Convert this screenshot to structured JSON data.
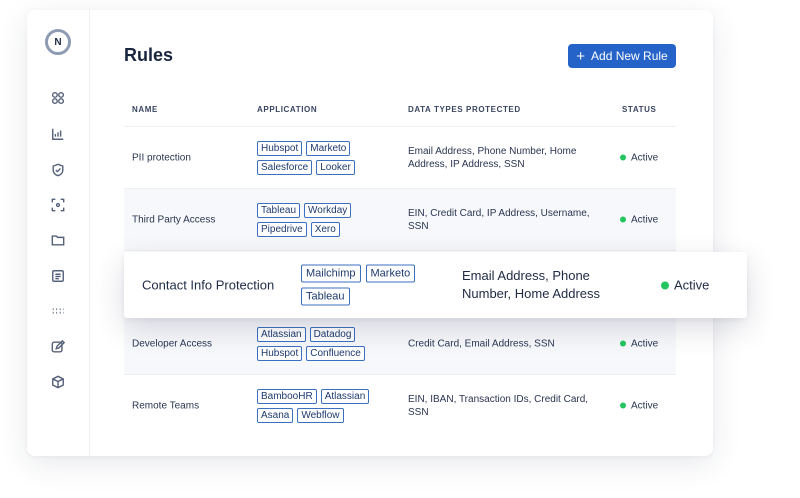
{
  "page": {
    "title": "Rules",
    "add_button": "Add New Rule"
  },
  "columns": {
    "name": "NAME",
    "application": "APPLICATION",
    "data_types": "DATA TYPES PROTECTED",
    "status": "STATUS"
  },
  "logo": {
    "letter": "N"
  },
  "sidebar": {
    "icons": [
      "grid-icon",
      "chart-icon",
      "shield-icon",
      "scan-icon",
      "folder-icon",
      "document-icon",
      "dots-icon",
      "edit-icon",
      "cube-icon"
    ]
  },
  "rows": [
    {
      "name": "PII protection",
      "apps": [
        "Hubspot",
        "Marketo",
        "Salesforce",
        "Looker"
      ],
      "data_types": "Email Address, Phone Number, Home Address, IP Address, SSN",
      "status": "Active"
    },
    {
      "name": "Third Party Access",
      "apps": [
        "Tableau",
        "Workday",
        "Pipedrive",
        "Xero"
      ],
      "data_types": "EIN, Credit Card, IP Address, Username, SSN",
      "status": "Active"
    },
    {
      "name": "Developer Access",
      "apps": [
        "Atlassian",
        "Datadog",
        "Hubspot",
        "Confluence"
      ],
      "data_types": "Credit Card, Email Address, SSN",
      "status": "Active"
    },
    {
      "name": "Remote Teams",
      "apps": [
        "BambooHR",
        "Atlassian",
        "Asana",
        "Webflow"
      ],
      "data_types": "EIN, IBAN, Transaction IDs, Credit Card, SSN",
      "status": "Active"
    }
  ],
  "highlight": {
    "name": "Contact Info Protection",
    "apps": [
      "Mailchimp",
      "Marketo",
      "Tableau"
    ],
    "data_types": "Email Address, Phone Number, Home Address",
    "status": "Active"
  },
  "colors": {
    "accent": "#2563c9",
    "active": "#22c55e"
  }
}
